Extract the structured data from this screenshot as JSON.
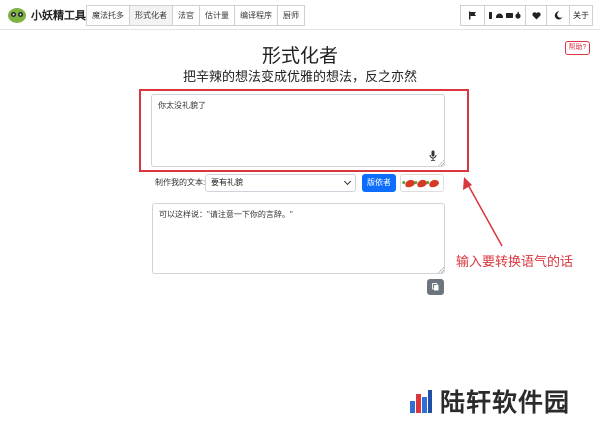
{
  "brand": {
    "name": "小妖精工具",
    "logo_icon": "frog-face-icon"
  },
  "nav": {
    "tabs": [
      {
        "label": "魔法托多"
      },
      {
        "label": "形式化者",
        "active": true
      },
      {
        "label": "法官"
      },
      {
        "label": "估计量"
      },
      {
        "label": "编译程序"
      },
      {
        "label": "厨师"
      }
    ],
    "right": {
      "flag_icon": "flag-icon",
      "platforms_icon": "platform-icons",
      "heart_icon": "heart-icon",
      "moon_icon": "moon-icon",
      "about_label": "关于"
    }
  },
  "help": {
    "label": "帮助?"
  },
  "page": {
    "title": "形式化者",
    "subtitle": "把辛辣的想法变成优雅的想法，反之亦然"
  },
  "input": {
    "value": "你太没礼貌了",
    "mic_icon": "microphone-icon"
  },
  "controls": {
    "label": "制作我的文本:",
    "selected_option": "要有礼貌",
    "submit_label": "版依者",
    "spice_icon": "chili-pepper-icon",
    "spice_level": 3
  },
  "output": {
    "value": "可以这样说：\"请注意一下你的言辞。\"",
    "copy_icon": "copy-icon"
  },
  "annotation": {
    "text": "输入要转换语气的话"
  },
  "watermark": {
    "text": "陆轩软件园",
    "logo_icon": "building-logo-icon"
  },
  "colors": {
    "accent": "#0d6efd",
    "annotation": "#d9363e",
    "copy_button": "#6c757d"
  }
}
